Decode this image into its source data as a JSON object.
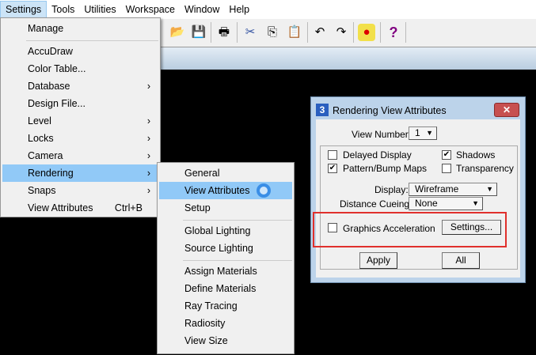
{
  "menubar": [
    "Settings",
    "Tools",
    "Utilities",
    "Workspace",
    "Window",
    "Help"
  ],
  "toolbar_icons": [
    "open-folder-icon",
    "save-icon",
    "print-icon",
    "cut-icon",
    "copy-icon",
    "paste-icon",
    "undo-icon",
    "redo-icon",
    "render-icon",
    "help-icon"
  ],
  "settings_menu": {
    "items": [
      {
        "label": "Manage"
      },
      {
        "label": "AccuDraw"
      },
      {
        "label": "Color Table..."
      },
      {
        "label": "Database",
        "submenu": true
      },
      {
        "label": "Design File..."
      },
      {
        "label": "Level",
        "submenu": true
      },
      {
        "label": "Locks",
        "submenu": true
      },
      {
        "label": "Camera",
        "submenu": true
      },
      {
        "label": "Rendering",
        "submenu": true
      },
      {
        "label": "Snaps",
        "submenu": true
      },
      {
        "label": "View Attributes",
        "shortcut": "Ctrl+B"
      }
    ]
  },
  "rendering_menu": {
    "items": [
      "General",
      "View Attributes",
      "Setup",
      "Global Lighting",
      "Source Lighting",
      "Assign Materials",
      "Define Materials",
      "Ray Tracing",
      "Radiosity",
      "View Size"
    ]
  },
  "dialog": {
    "title": "Rendering View Attributes",
    "close": "✕",
    "view_number_label": "View Number:",
    "view_number": "1",
    "delayed_display": "Delayed Display",
    "shadows": "Shadows",
    "pattern_bump": "Pattern/Bump Maps",
    "transparency": "Transparency",
    "display_label": "Display:",
    "display_value": "Wireframe",
    "cueing_label": "Distance Cueing:",
    "cueing_value": "None",
    "graphics_accel": "Graphics Acceleration",
    "settings_btn": "Settings...",
    "apply_btn": "Apply",
    "all_btn": "All",
    "checks": {
      "delayed_display": false,
      "shadows": true,
      "pattern_bump": true,
      "transparency": false,
      "graphics_accel": false
    }
  },
  "colors": {
    "highlight": "#91c9f7",
    "annotation": "#e0302c"
  }
}
